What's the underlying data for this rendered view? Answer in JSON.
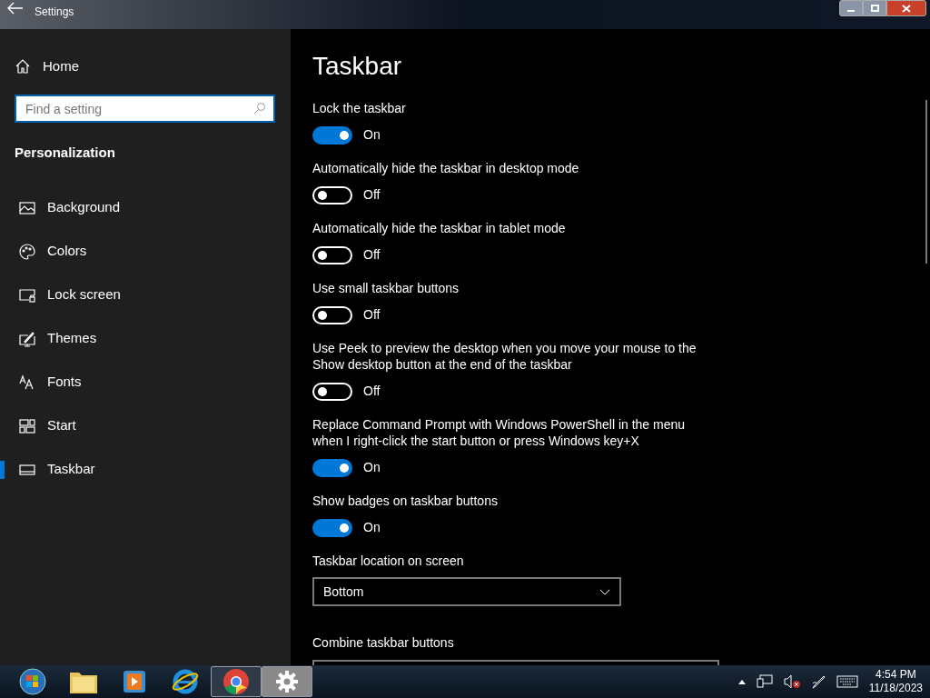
{
  "window": {
    "title": "Settings"
  },
  "sidebar": {
    "home": "Home",
    "search": {
      "placeholder": "Find a setting"
    },
    "section": "Personalization",
    "items": [
      {
        "label": "Background",
        "selected": false
      },
      {
        "label": "Colors",
        "selected": false
      },
      {
        "label": "Lock screen",
        "selected": false
      },
      {
        "label": "Themes",
        "selected": false
      },
      {
        "label": "Fonts",
        "selected": false
      },
      {
        "label": "Start",
        "selected": false
      },
      {
        "label": "Taskbar",
        "selected": true
      }
    ]
  },
  "page": {
    "title": "Taskbar",
    "settings": [
      {
        "kind": "toggle",
        "label": "Lock the taskbar",
        "on": true,
        "state_text": "On"
      },
      {
        "kind": "toggle",
        "label": "Automatically hide the taskbar in desktop mode",
        "on": false,
        "state_text": "Off"
      },
      {
        "kind": "toggle",
        "label": "Automatically hide the taskbar in tablet mode",
        "on": false,
        "state_text": "Off"
      },
      {
        "kind": "toggle",
        "label": "Use small taskbar buttons",
        "on": false,
        "state_text": "Off"
      },
      {
        "kind": "toggle",
        "label": "Use Peek to preview the desktop when you move your mouse to the Show desktop button at the end of the taskbar",
        "on": false,
        "state_text": "Off"
      },
      {
        "kind": "toggle",
        "label": "Replace Command Prompt with Windows PowerShell in the menu when I right-click the start button or press Windows key+X",
        "on": true,
        "state_text": "On"
      },
      {
        "kind": "toggle",
        "label": "Show badges on taskbar buttons",
        "on": true,
        "state_text": "On"
      },
      {
        "kind": "dropdown",
        "label": "Taskbar location on screen",
        "value": "Bottom"
      },
      {
        "kind": "dropdown_cut",
        "label": "Combine taskbar buttons"
      }
    ]
  },
  "taskbar": {
    "apps": [
      {
        "running": false,
        "selected": false
      },
      {
        "running": false,
        "selected": false
      },
      {
        "running": false,
        "selected": false
      },
      {
        "running": false,
        "selected": false
      },
      {
        "running": true,
        "selected": false
      },
      {
        "running": true,
        "selected": true
      }
    ],
    "time": "4:54 PM",
    "date": "11/18/2023"
  }
}
